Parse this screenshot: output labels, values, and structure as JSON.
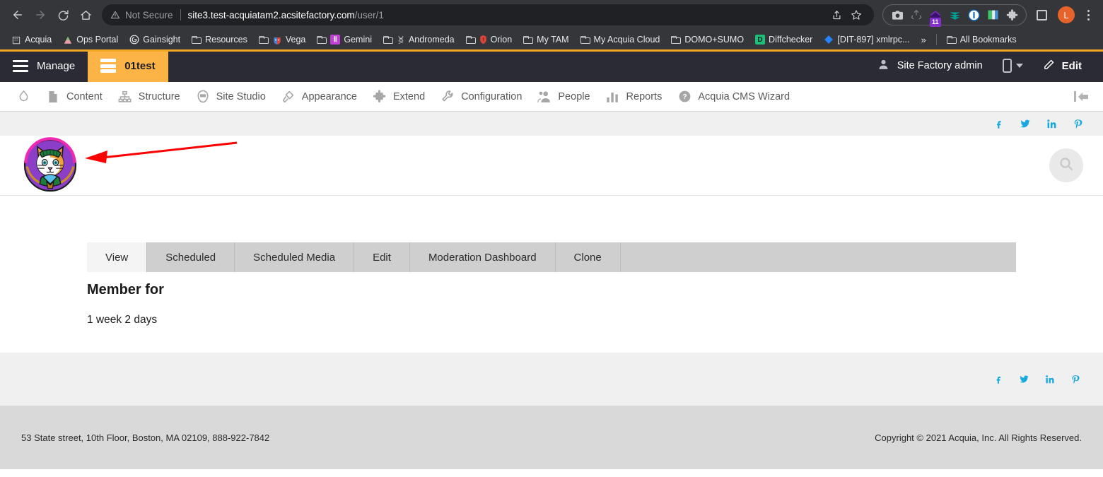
{
  "browser": {
    "nav": {
      "back": "back-arrow",
      "forward": "forward-arrow",
      "reload": "reload",
      "home": "home"
    },
    "omnibox": {
      "security_label": "Not Secure",
      "url_host": "site3.test-acquiatam2.acsitefactory.com",
      "url_path": "/user/1",
      "share_icon": "share-icon",
      "bookmark_icon": "star-icon"
    },
    "extensions": [
      {
        "name": "screenshot-extension",
        "glyph": "📷",
        "badge": null
      },
      {
        "name": "recycle-extension",
        "glyph": "♻",
        "badge": null
      },
      {
        "name": "purple-extension",
        "glyph": "",
        "badge": "11"
      },
      {
        "name": "evernote-extension",
        "glyph": "",
        "badge": null
      },
      {
        "name": "onepassword-extension",
        "glyph": "",
        "badge": null
      },
      {
        "name": "color-extension",
        "glyph": "",
        "badge": null
      },
      {
        "name": "puzzle-extension",
        "glyph": "🧩",
        "badge": null
      }
    ],
    "profile_initial": "L",
    "menu_icon": "kebab-menu-icon"
  },
  "bookmarks": {
    "items": [
      {
        "label": "Acquia",
        "icon": "building-icon",
        "type": "site"
      },
      {
        "label": "Ops Portal",
        "icon": "mountain-icon",
        "type": "site"
      },
      {
        "label": "Gainsight",
        "icon": "gainsight-icon",
        "type": "site"
      },
      {
        "label": "Resources",
        "icon": "folder-icon",
        "type": "folder"
      },
      {
        "label": "Vega",
        "icon": "mask-icon",
        "type": "folder"
      },
      {
        "label": "Gemini",
        "icon": "gemini-icon",
        "type": "folder"
      },
      {
        "label": "Andromeda",
        "icon": "dna-icon",
        "type": "folder"
      },
      {
        "label": "Orion",
        "icon": "shield-icon",
        "type": "folder"
      },
      {
        "label": "My TAM",
        "icon": "folder-icon",
        "type": "folder"
      },
      {
        "label": "My Acquia Cloud",
        "icon": "folder-icon",
        "type": "folder"
      },
      {
        "label": "DOMO+SUMO",
        "icon": "folder-icon",
        "type": "folder"
      },
      {
        "label": "Diffchecker",
        "icon": "diffchecker-icon",
        "type": "site"
      },
      {
        "label": "[DIT-897] xmlrpc...",
        "icon": "jira-icon",
        "type": "site"
      }
    ],
    "overflow_label": "»",
    "all_bookmarks_label": "All Bookmarks"
  },
  "drupal_toolbar": {
    "manage_label": "Manage",
    "site_label": "01test",
    "user_label": "Site Factory admin",
    "edit_label": "Edit",
    "device_icon": "mobile-preview-icon",
    "accent_color": "#f5a623",
    "active_tab_color": "#fdb446"
  },
  "admin_menu": {
    "items": [
      {
        "label": "",
        "icon": "drupal-drop-icon"
      },
      {
        "label": "Content",
        "icon": "file-icon"
      },
      {
        "label": "Structure",
        "icon": "structure-icon"
      },
      {
        "label": "Site Studio",
        "icon": "site-studio-icon"
      },
      {
        "label": "Appearance",
        "icon": "paintbrush-icon"
      },
      {
        "label": "Extend",
        "icon": "puzzle-icon"
      },
      {
        "label": "Configuration",
        "icon": "wrench-icon"
      },
      {
        "label": "People",
        "icon": "people-icon"
      },
      {
        "label": "Reports",
        "icon": "bar-chart-icon"
      },
      {
        "label": "Acquia CMS Wizard",
        "icon": "question-circle-icon"
      }
    ],
    "collapse_icon": "collapse-sidebar-icon"
  },
  "social": {
    "items": [
      {
        "name": "facebook-icon",
        "glyph": "f"
      },
      {
        "name": "twitter-icon",
        "glyph": "🐦"
      },
      {
        "name": "linkedin-icon",
        "glyph": "in"
      },
      {
        "name": "pinterest-icon",
        "glyph": "P"
      }
    ],
    "color": "#17a8e0"
  },
  "site_header": {
    "logo_name": "cat-avatar-logo",
    "search_icon": "search-icon",
    "annotation": {
      "name": "red-arrow-annotation",
      "color": "#ff0000"
    }
  },
  "main": {
    "tabs": [
      {
        "label": "View",
        "active": true
      },
      {
        "label": "Scheduled",
        "active": false
      },
      {
        "label": "Scheduled Media",
        "active": false
      },
      {
        "label": "Edit",
        "active": false
      },
      {
        "label": "Moderation Dashboard",
        "active": false
      },
      {
        "label": "Clone",
        "active": false
      }
    ],
    "member_for_title": "Member for",
    "member_for_value": "1 week 2 days"
  },
  "footer": {
    "address": "53 State street, 10th Floor, Boston, MA 02109, 888-922-7842",
    "copyright": "Copyright © 2021 Acquia, Inc. All Rights Reserved."
  }
}
